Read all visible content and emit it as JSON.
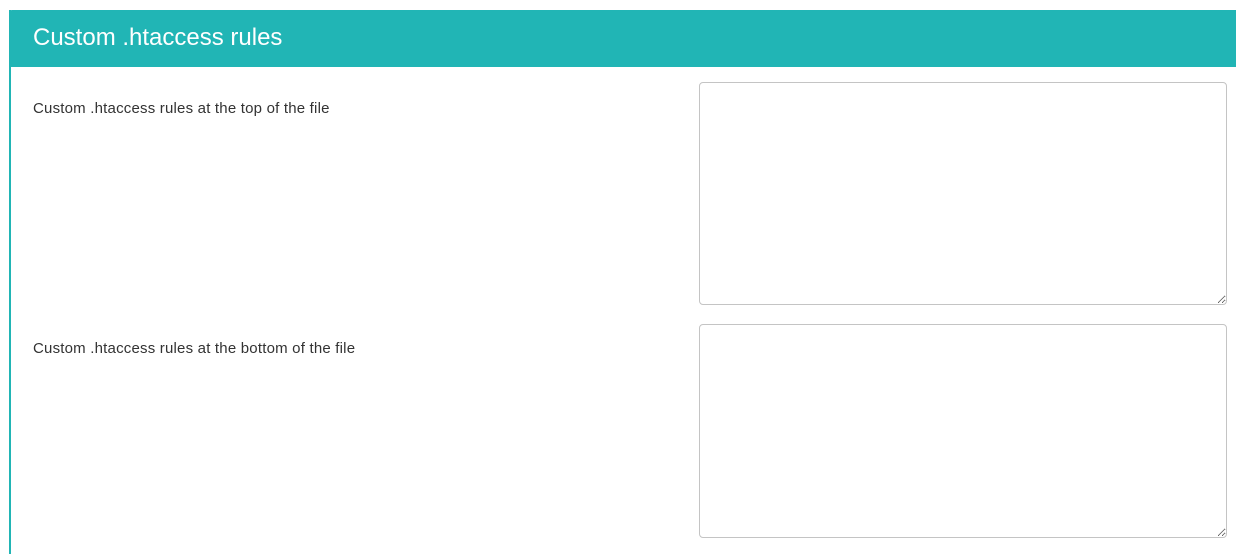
{
  "panel": {
    "title": "Custom .htaccess rules"
  },
  "fields": [
    {
      "label": "Custom .htaccess rules at the top of the file",
      "value": ""
    },
    {
      "label": "Custom .htaccess rules at the bottom of the file",
      "value": ""
    }
  ],
  "colors": {
    "accent": "#21b5b5",
    "header_text": "#ffffff",
    "label_text": "#333333",
    "input_border": "#c4c4c4"
  }
}
